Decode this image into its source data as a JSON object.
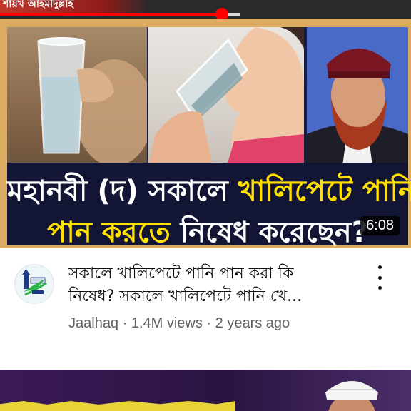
{
  "previous_card": {
    "channel_overlay_text": "শায়খ আহমাদুল্লাহ"
  },
  "player": {
    "progress_fraction": 0.54,
    "accent_color": "#ff0000"
  },
  "video": {
    "thumbnail_title_line1_a": "মহানবী (দ) সকালে ",
    "thumbnail_title_line1_b": "খালিপেটে পানি",
    "thumbnail_title_line2_a": "পান করতে ",
    "thumbnail_title_line2_b": "নিষেধ করেছেন?",
    "duration": "6:08",
    "title_line1": "সকালে খালিপেটে পানি পান করা কি",
    "title_line2": "নিষেধ? সকালে খালিপেটে পানি খে...",
    "channel_name": "Jaalhaq",
    "views": "1.4M views",
    "age": "2 years ago",
    "separator": " · "
  },
  "icons": {
    "channel_avatar": "jaalhaq-logo-icon",
    "more_actions": "kebab-menu-icon"
  }
}
